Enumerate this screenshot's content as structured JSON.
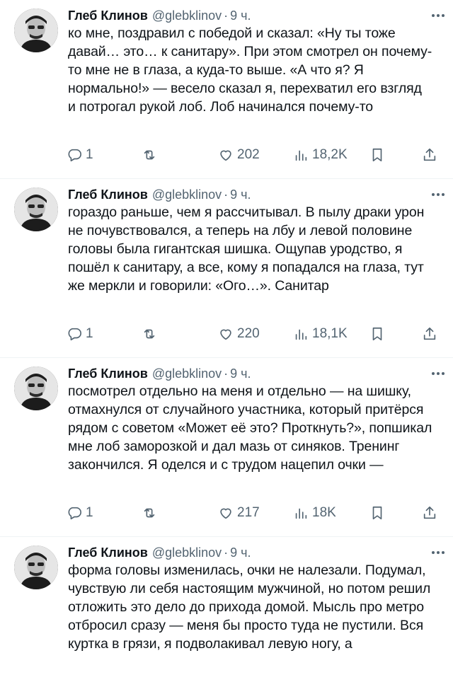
{
  "tweets": [
    {
      "author": "Глеб Клинов",
      "handle": "@glebklinov",
      "separator": "·",
      "time": "9 ч.",
      "text": "ко мне, поздравил с победой и сказал: «Ну ты тоже давай… это… к санитару». При этом смотрел он почему-то мне не в глаза, а куда-то выше. «А что я? Я нормально!» — весело сказал я, перехватил его взгляд и потрогал рукой лоб. Лоб начинался почему-то",
      "replies": "1",
      "likes": "202",
      "views": "18,2K"
    },
    {
      "author": "Глеб Клинов",
      "handle": "@glebklinov",
      "separator": "·",
      "time": "9 ч.",
      "text": "гораздо раньше, чем я рассчитывал. В пылу драки урон не почувствовался, а теперь на лбу и левой половине головы была гигантская шишка. Ощупав уродство, я пошёл к санитару, а все, кому я попадался на глаза, тут же меркли и говорили: «Ого…». Санитар",
      "replies": "1",
      "likes": "220",
      "views": "18,1K"
    },
    {
      "author": "Глеб Клинов",
      "handle": "@glebklinov",
      "separator": "·",
      "time": "9 ч.",
      "text": "посмотрел отдельно на меня и отдельно — на шишку, отмахнулся от случайного участника, который притёрся рядом с советом «Может её это? Проткнуть?», попшикал мне лоб заморозкой и дал мазь от синяков. Тренинг закончился. Я оделся и с трудом нацепил очки —",
      "replies": "1",
      "likes": "217",
      "views": "18K"
    },
    {
      "author": "Глеб Клинов",
      "handle": "@glebklinov",
      "separator": "·",
      "time": "9 ч.",
      "text": "форма головы изменилась, очки не налезали. Подумал, чувствую ли себя настоящим мужчиной, но потом решил отложить это дело до прихода домой. Мысль про метро отбросил сразу — меня бы просто туда не пустили. Вся куртка в грязи, я подволакивал левую ногу, а",
      "replies": "",
      "likes": "",
      "views": ""
    }
  ],
  "icons": {
    "reply": "reply-icon",
    "retweet": "retweet-icon",
    "like": "heart-icon",
    "views": "views-icon",
    "bookmark": "bookmark-icon",
    "share": "share-icon",
    "more": "more-icon"
  },
  "colors": {
    "text": "#0f1419",
    "secondary": "#536471",
    "divider": "#eff3f4"
  }
}
